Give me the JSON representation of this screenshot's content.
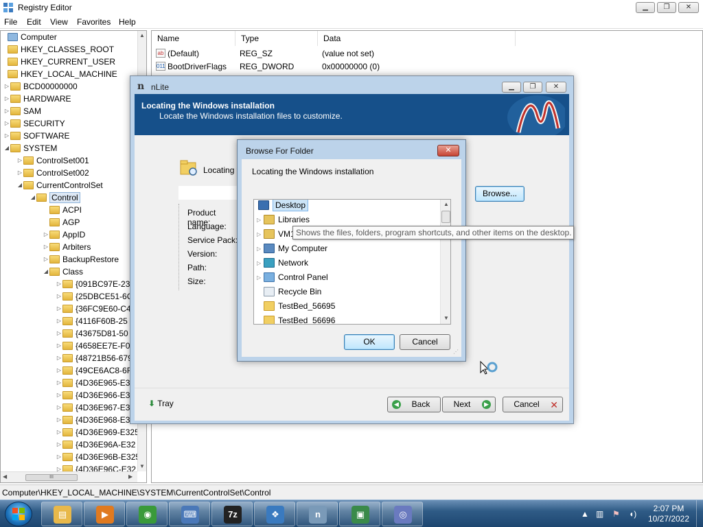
{
  "regedit": {
    "title": "Registry Editor",
    "menu": [
      "File",
      "Edit",
      "View",
      "Favorites",
      "Help"
    ],
    "window_buttons": {
      "minimize": "▁",
      "maximize": "❐",
      "close": "✕"
    },
    "tree": [
      {
        "label": "Computer",
        "depth": 0,
        "expander": ""
      },
      {
        "label": "HKEY_CLASSES_ROOT",
        "depth": 0,
        "expander": ""
      },
      {
        "label": "HKEY_CURRENT_USER",
        "depth": 0,
        "expander": ""
      },
      {
        "label": "HKEY_LOCAL_MACHINE",
        "depth": 0,
        "expander": ""
      },
      {
        "label": "BCD00000000",
        "depth": 1,
        "expander": "▷"
      },
      {
        "label": "HARDWARE",
        "depth": 1,
        "expander": "▷"
      },
      {
        "label": "SAM",
        "depth": 1,
        "expander": "▷"
      },
      {
        "label": "SECURITY",
        "depth": 1,
        "expander": "▷"
      },
      {
        "label": "SOFTWARE",
        "depth": 1,
        "expander": "▷"
      },
      {
        "label": "SYSTEM",
        "depth": 1,
        "expander": "◢"
      },
      {
        "label": "ControlSet001",
        "depth": 2,
        "expander": "▷"
      },
      {
        "label": "ControlSet002",
        "depth": 2,
        "expander": "▷"
      },
      {
        "label": "CurrentControlSet",
        "depth": 2,
        "expander": "◢"
      },
      {
        "label": "Control",
        "depth": 3,
        "expander": "◢",
        "selected": true
      },
      {
        "label": "ACPI",
        "depth": 4,
        "expander": ""
      },
      {
        "label": "AGP",
        "depth": 4,
        "expander": ""
      },
      {
        "label": "AppID",
        "depth": 4,
        "expander": "▷"
      },
      {
        "label": "Arbiters",
        "depth": 4,
        "expander": "▷"
      },
      {
        "label": "BackupRestore",
        "depth": 4,
        "expander": "▷"
      },
      {
        "label": "Class",
        "depth": 4,
        "expander": "◢"
      },
      {
        "label": "{091BC97E-23",
        "depth": 5,
        "expander": "▷"
      },
      {
        "label": "{25DBCE51-6C",
        "depth": 5,
        "expander": "▷"
      },
      {
        "label": "{36FC9E60-C4",
        "depth": 5,
        "expander": "▷"
      },
      {
        "label": "{4116F60B-25",
        "depth": 5,
        "expander": "▷"
      },
      {
        "label": "{43675D81-50",
        "depth": 5,
        "expander": "▷"
      },
      {
        "label": "{4658EE7E-F05",
        "depth": 5,
        "expander": "▷"
      },
      {
        "label": "{48721B56-679",
        "depth": 5,
        "expander": "▷"
      },
      {
        "label": "{49CE6AC8-6F",
        "depth": 5,
        "expander": "▷"
      },
      {
        "label": "{4D36E965-E3",
        "depth": 5,
        "expander": "▷"
      },
      {
        "label": "{4D36E966-E3",
        "depth": 5,
        "expander": "▷"
      },
      {
        "label": "{4D36E967-E3",
        "depth": 5,
        "expander": "▷"
      },
      {
        "label": "{4D36E968-E3",
        "depth": 5,
        "expander": "▷"
      },
      {
        "label": "{4D36E969-E325",
        "depth": 5,
        "expander": "▷"
      },
      {
        "label": "{4D36E96A-E32",
        "depth": 5,
        "expander": "▷"
      },
      {
        "label": "{4D36E96B-E325",
        "depth": 5,
        "expander": "▷"
      },
      {
        "label": "{4D36E96C-E32",
        "depth": 5,
        "expander": "▷"
      }
    ],
    "columns": [
      "Name",
      "Type",
      "Data"
    ],
    "values": [
      {
        "icon": "ab",
        "name": "(Default)",
        "type": "REG_SZ",
        "data": "(value not set)"
      },
      {
        "icon": "011",
        "name": "BootDriverFlags",
        "type": "REG_DWORD",
        "data": "0x00000000 (0)"
      }
    ],
    "hscroll_grip": "III",
    "status": "Computer\\HKEY_LOCAL_MACHINE\\SYSTEM\\CurrentControlSet\\Control"
  },
  "nlite": {
    "title": "nLite",
    "logo": "n",
    "header_title": "Locating the Windows installation",
    "header_subtitle": "Locate the Windows installation files to customize.",
    "locating_label": "Locating th",
    "browse_label": "Browse...",
    "info_labels": [
      "Product name:",
      "Language:",
      "Service Pack:",
      "Version:",
      "Path:",
      "Size:"
    ],
    "tray_label": "Tray",
    "back_label": "Back",
    "next_label": "Next",
    "cancel_label": "Cancel"
  },
  "browse_dialog": {
    "title": "Browse For Folder",
    "close": "✕",
    "prompt": "Locating the Windows installation",
    "items": [
      {
        "label": "Desktop",
        "icon": "desktop-icon",
        "expander": "",
        "selected": true
      },
      {
        "label": "Libraries",
        "icon": "libraries-icon",
        "expander": "▷"
      },
      {
        "label": "VM1",
        "icon": "user-folder-icon",
        "expander": "▷"
      },
      {
        "label": "My Computer",
        "icon": "computer-icon",
        "expander": "▷"
      },
      {
        "label": "Network",
        "icon": "network-icon",
        "expander": "▷"
      },
      {
        "label": "Control Panel",
        "icon": "control-panel-icon",
        "expander": "▷"
      },
      {
        "label": "Recycle Bin",
        "icon": "recycle-bin-icon",
        "expander": ""
      },
      {
        "label": "TestBed_56695",
        "icon": "folder-icon",
        "expander": ""
      },
      {
        "label": "TestBed_56696",
        "icon": "folder-icon",
        "expander": ""
      }
    ],
    "ok_label": "OK",
    "cancel_label": "Cancel",
    "tooltip": "Shows the files, folders, program shortcuts, and other items on the desktop."
  },
  "taskbar": {
    "pinned": [
      {
        "name": "explorer-icon",
        "glyph": "▤",
        "color": "#e8b84a"
      },
      {
        "name": "media-player-icon",
        "glyph": "▶",
        "color": "#e07a20"
      },
      {
        "name": "chrome-icon",
        "glyph": "◉",
        "color": "#3a9a3a"
      },
      {
        "name": "keyboard-app-icon",
        "glyph": "⌨",
        "color": "#4a78b8"
      },
      {
        "name": "7zip-icon",
        "glyph": "7z",
        "color": "#222222"
      },
      {
        "name": "package-icon",
        "glyph": "❖",
        "color": "#3a7abf"
      },
      {
        "name": "nlite-icon",
        "glyph": "n",
        "color": "#7a9ab8"
      },
      {
        "name": "device-manager-icon",
        "glyph": "▣",
        "color": "#3a8a4a"
      },
      {
        "name": "torrent-icon",
        "glyph": "◎",
        "color": "#6a7abf"
      }
    ],
    "time": "2:07 PM",
    "date": "10/27/2022"
  }
}
